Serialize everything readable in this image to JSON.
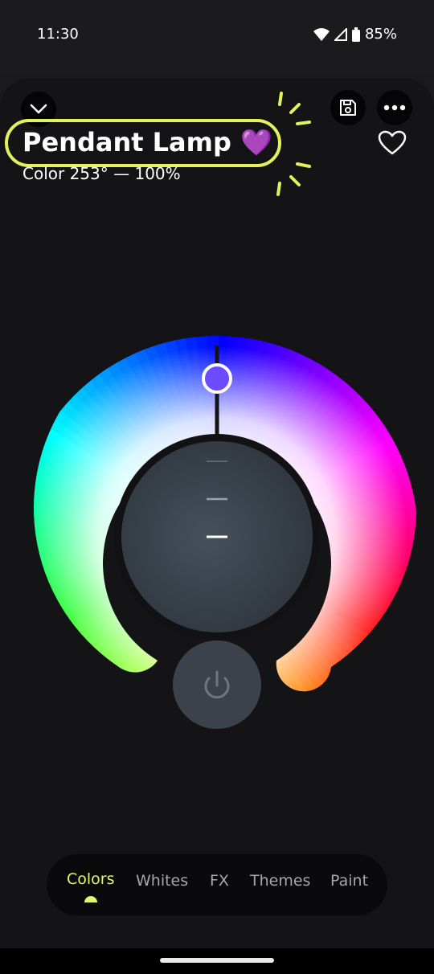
{
  "status": {
    "time": "11:30",
    "battery": "85%"
  },
  "header": {
    "title": "Pendant Lamp 💜",
    "subtitle": "Color 253° — 100%"
  },
  "controls": {
    "brightness_levels": 3,
    "selected_hue": 253
  },
  "tabs": [
    {
      "label": "Colors",
      "active": true
    },
    {
      "label": "Whites",
      "active": false
    },
    {
      "label": "FX",
      "active": false
    },
    {
      "label": "Themes",
      "active": false
    },
    {
      "label": "Paint",
      "active": false
    }
  ],
  "colors": {
    "accent": "#e3f25a",
    "background": "#141417"
  }
}
